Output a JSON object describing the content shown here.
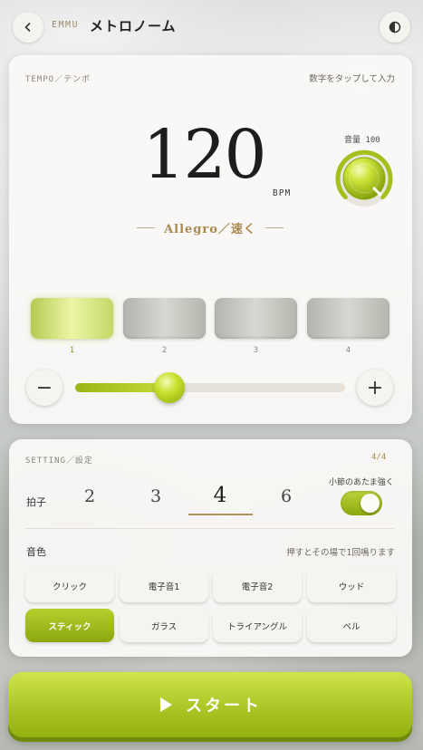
{
  "header": {
    "back_icon": "chevron-left-icon",
    "brand": "EMMU",
    "title": "メトロノーム",
    "theme_icon": "contrast-icon"
  },
  "tempo": {
    "section_label": "TEMPO／テンポ",
    "hint": "数字をタップして入力",
    "bpm": "120",
    "unit": "BPM",
    "tempo_name": "Allegro／速く",
    "volume_label": "音量 100",
    "volume": 100,
    "beats": [
      {
        "label": "1",
        "active": true
      },
      {
        "label": "2",
        "active": false
      },
      {
        "label": "3",
        "active": false
      },
      {
        "label": "4",
        "active": false
      }
    ],
    "decrease_label": "−",
    "increase_label": "+",
    "slider_fraction": 0.35
  },
  "setting": {
    "section_label": "SETTING／設定",
    "meter": "4/4",
    "beats_label": "拍子",
    "beat_options": [
      "2",
      "3",
      "4",
      "6"
    ],
    "selected_beat": "4",
    "accent_label": "小節のあたま強く",
    "accent_on": true,
    "sound_label": "音色",
    "sound_hint": "押すとその場で1回鳴ります",
    "sounds": [
      {
        "label": "クリック",
        "active": false
      },
      {
        "label": "電子音1",
        "active": false
      },
      {
        "label": "電子音2",
        "active": false
      },
      {
        "label": "ウッド",
        "active": false
      },
      {
        "label": "スティック",
        "active": true
      },
      {
        "label": "ガラス",
        "active": false
      },
      {
        "label": "トライアングル",
        "active": false
      },
      {
        "label": "ベル",
        "active": false
      }
    ]
  },
  "start": {
    "label": "スタート",
    "icon": "play-icon"
  },
  "colors": {
    "accent": "#a8c323",
    "accent_dark": "#8aa70e",
    "gold": "#a8894f"
  }
}
